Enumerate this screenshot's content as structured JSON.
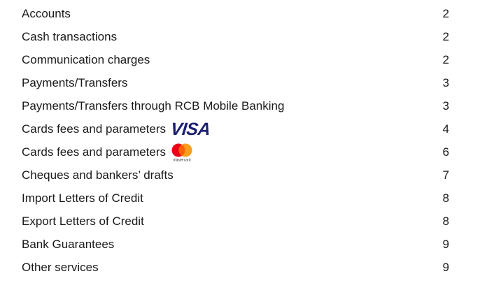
{
  "toc": {
    "items": [
      {
        "label": "Accounts",
        "page": "2"
      },
      {
        "label": "Cash transactions",
        "page": "2"
      },
      {
        "label": "Communication charges",
        "page": "2"
      },
      {
        "label": "Payments/Transfers",
        "page": "3"
      },
      {
        "label": "Payments/Transfers through RCB Mobile Banking",
        "page": "3"
      },
      {
        "label": "Cards fees and parameters",
        "page": "4",
        "logo": "visa-logo",
        "logo_text": "VISA"
      },
      {
        "label": "Cards fees and parameters",
        "page": "6",
        "logo": "mastercard-logo",
        "logo_text": "mastercard"
      },
      {
        "label": "Cheques and bankers’ drafts",
        "page": "7"
      },
      {
        "label": "Import Letters of Credit",
        "page": "8"
      },
      {
        "label": "Export Letters of Credit",
        "page": "8"
      },
      {
        "label": "Bank Guarantees",
        "page": "9"
      },
      {
        "label": "Other services",
        "page": "9"
      }
    ]
  },
  "colors": {
    "text": "#1a1a1a",
    "visa_blue": "#1a1f71",
    "mastercard_red": "#eb001b",
    "mastercard_orange": "#f79e1b",
    "mastercard_overlap": "#ff5f00"
  }
}
